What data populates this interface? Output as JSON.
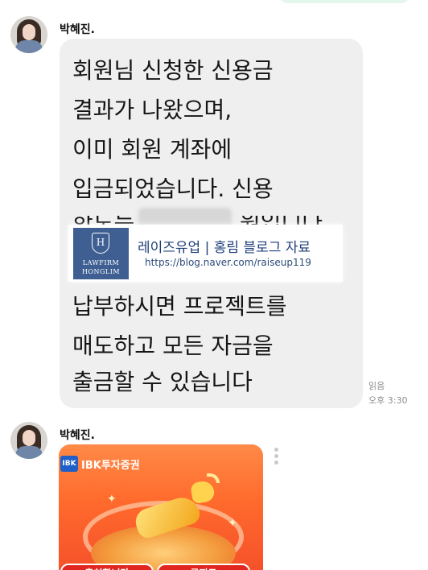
{
  "messages": [
    {
      "sender": "박혜진.",
      "text_lines": [
        "회원님 신청한 신용금",
        "결과가 나왔으며,",
        "이미 회원 계좌에",
        "입금되었습니다. 신용",
        "한도는",
        "원입니다",
        "납부하시면 프로젝트를",
        "매도하고 모든 자금을",
        "출금할 수 있습니다"
      ],
      "read_status": "읽음",
      "time": "오후 3:30"
    },
    {
      "sender": "박혜진.",
      "card": {
        "brand": "IBK투자증권",
        "logo_text": "IBK",
        "buttons": [
          "출처합니다",
          "공지드"
        ]
      }
    }
  ],
  "link_preview": {
    "logo_letter": "H",
    "brand_line1": "LAWFIRM",
    "brand_line2": "HONGLIM",
    "title": "레이즈유업 | 홍림 블로그 자료",
    "url": "https://blog.naver.com/raiseup119"
  },
  "icons": [
    "avatar",
    "more-options-icon",
    "shield-icon",
    "bull-image"
  ],
  "colors": {
    "bubble": "#efefef",
    "link_title": "#1f3f7a",
    "card_orange": "#ff6a2c",
    "ibk_blue": "#1f5fc7"
  }
}
